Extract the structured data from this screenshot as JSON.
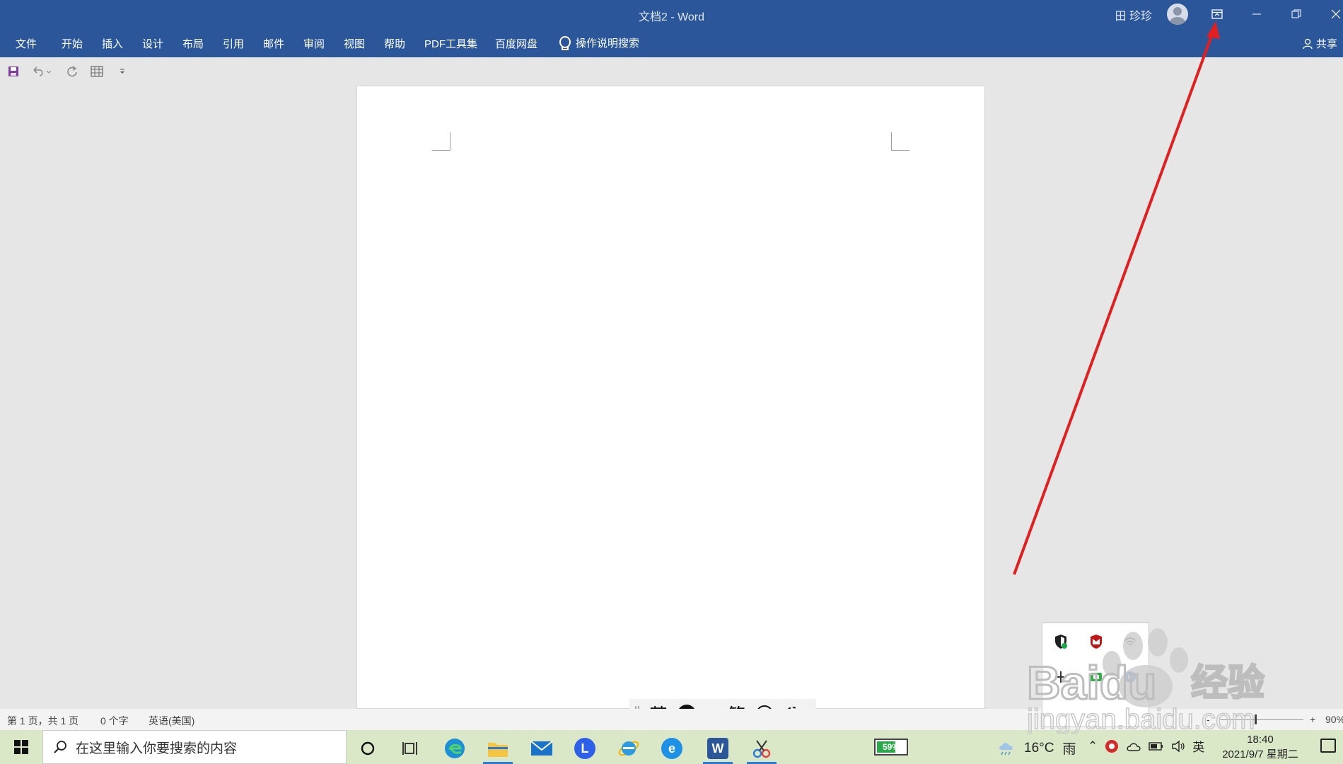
{
  "window": {
    "title": "文档2  -  Word",
    "user": "田 珍珍",
    "icons": {
      "ribbon_display": "ribbon-display-options-icon",
      "minimize": "minimize-icon",
      "restore": "restore-icon",
      "close": "close-icon"
    }
  },
  "ribbon": {
    "tabs": [
      "文件",
      "开始",
      "插入",
      "设计",
      "布局",
      "引用",
      "邮件",
      "审阅",
      "视图",
      "帮助",
      "PDF工具集",
      "百度网盘"
    ],
    "tell_me": "操作说明搜索",
    "share": "共享"
  },
  "qat": {
    "icons": [
      "save-icon",
      "undo-icon",
      "redo-icon",
      "table-icon",
      "customize-qat-icon"
    ]
  },
  "status": {
    "page": "第 1 页，共 1 页",
    "words": "0 个字",
    "language": "英语(美国)",
    "zoom_plus": "+",
    "zoom_minus": "-",
    "zoom": "90%"
  },
  "ime": {
    "mode": "英",
    "punct": "•,",
    "script": "简"
  },
  "taskbar": {
    "search_placeholder": "在这里输入你要搜索的内容",
    "apps": [
      "cortana-icon",
      "task-view-icon",
      "edge-icon",
      "file-explorer-icon",
      "mail-icon",
      "lark-icon",
      "ie-icon",
      "ie-alt-icon",
      "word-icon",
      "snipping-icon"
    ],
    "battery_widget": "59%",
    "weather_temp": "16°C",
    "weather_desc": "雨",
    "input_lang": "英",
    "time": "18:40",
    "date": "2021/9/7 星期二"
  },
  "watermark": {
    "brand": "Baidu",
    "brand_cn": "经验",
    "url": "jingyan.baidu.com"
  },
  "colors": {
    "ribbon": "#2b579a",
    "annotation": "#e02020"
  }
}
